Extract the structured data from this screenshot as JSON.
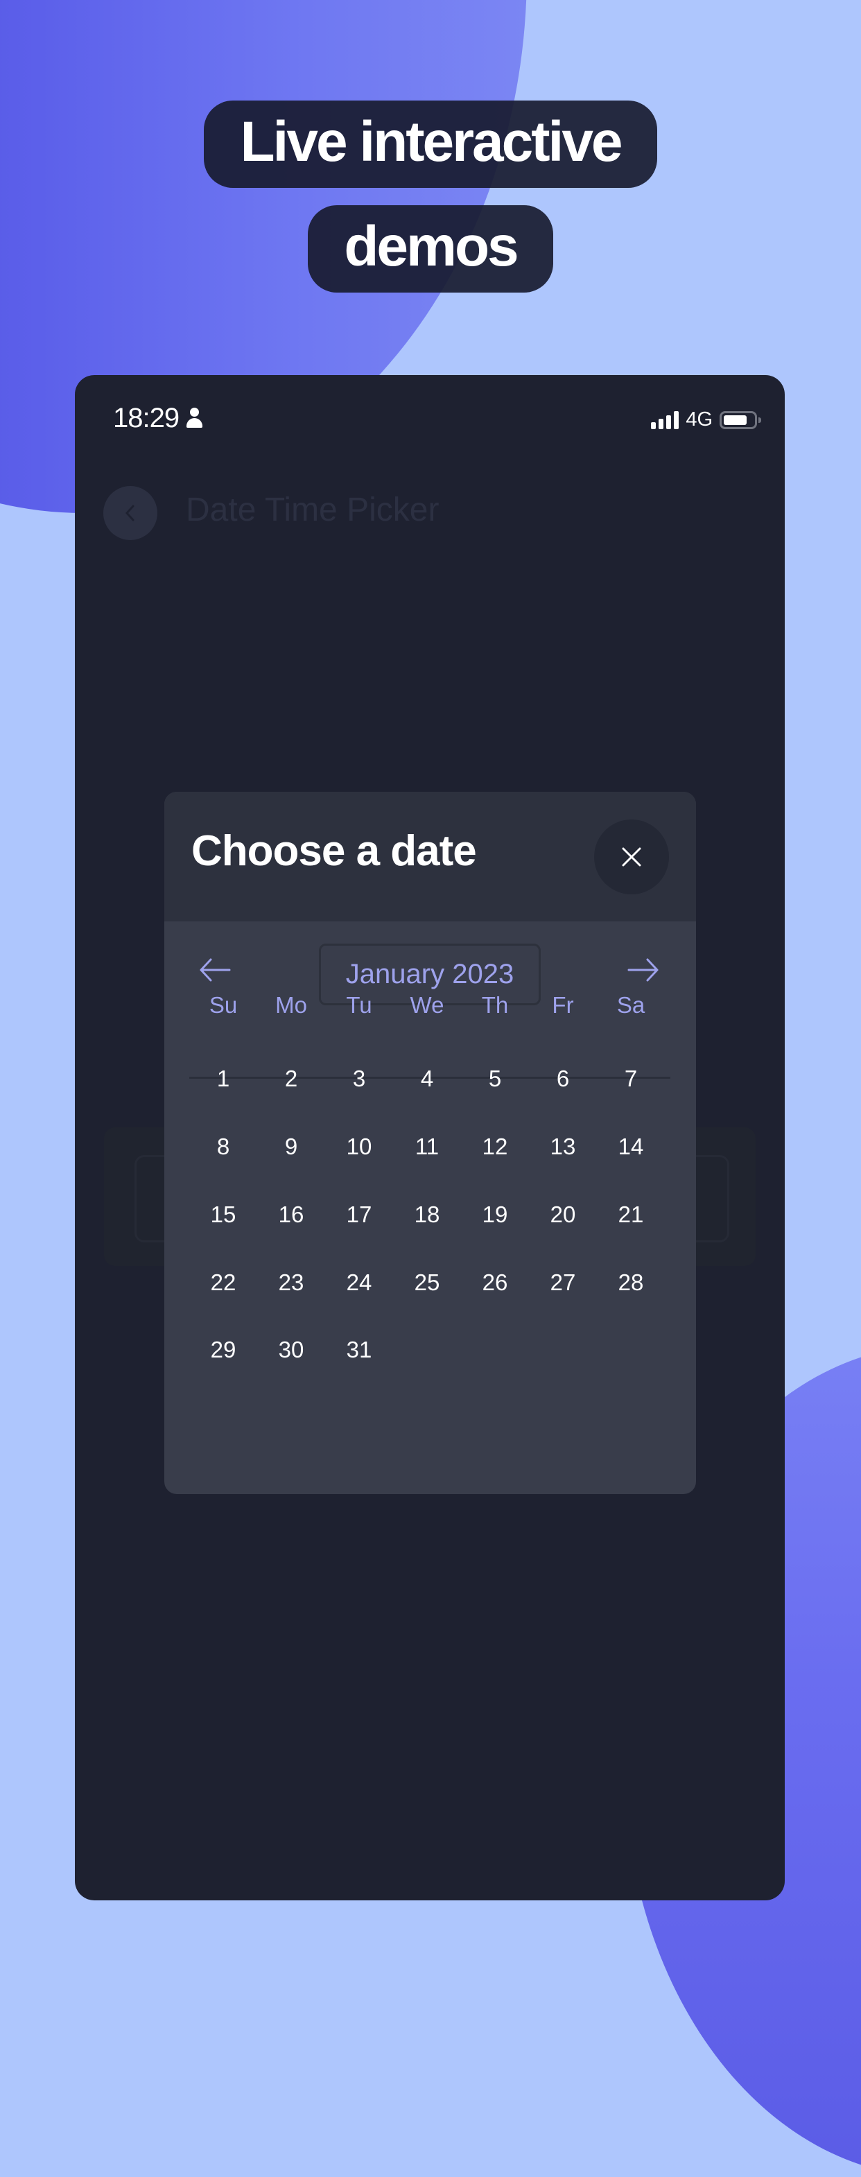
{
  "promo": {
    "headline_line1": "Live interactive",
    "headline_line2": "demos",
    "colors": {
      "background": "#aec6fd",
      "blob": "#5c60ea",
      "pill": "#181b30"
    }
  },
  "status_bar": {
    "time": "18:29",
    "network": "4G",
    "icons": [
      "person-icon",
      "signal-icon",
      "battery-icon"
    ]
  },
  "app_bar": {
    "back_icon": "chevron-left-icon",
    "title": "Date Time Picker"
  },
  "modal": {
    "title": "Choose a date",
    "close_icon": "close-icon",
    "prev_icon": "arrow-left-icon",
    "next_icon": "arrow-right-icon",
    "month_label": "January 2023",
    "weekdays": [
      "Su",
      "Mo",
      "Tu",
      "We",
      "Th",
      "Fr",
      "Sa"
    ],
    "weeks": [
      [
        "1",
        "2",
        "3",
        "4",
        "5",
        "6",
        "7"
      ],
      [
        "8",
        "9",
        "10",
        "11",
        "12",
        "13",
        "14"
      ],
      [
        "15",
        "16",
        "17",
        "18",
        "19",
        "20",
        "21"
      ],
      [
        "22",
        "23",
        "24",
        "25",
        "26",
        "27",
        "28"
      ],
      [
        "29",
        "30",
        "31",
        "",
        "",
        "",
        ""
      ]
    ],
    "colors": {
      "accent": "#9ea2ec",
      "header": "#2d313e",
      "body": "#393d4b"
    }
  }
}
